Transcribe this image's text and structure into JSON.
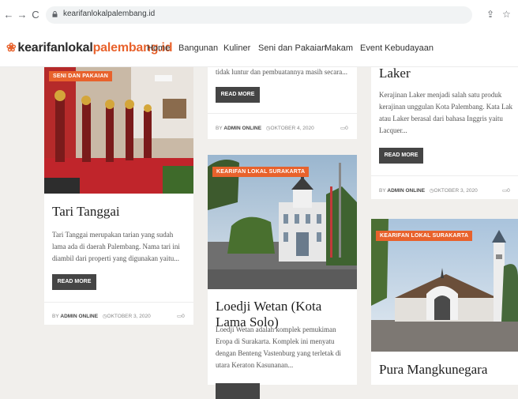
{
  "browser": {
    "url": "kearifanlokalpalembang.id",
    "back_glyph": "←",
    "forward_glyph": "→",
    "reload_glyph": "C",
    "share_glyph": "⇪",
    "star_glyph": "☆"
  },
  "site": {
    "logo_prefix": "kearifanlokal",
    "logo_accent": "palembang.id",
    "logo_mark": "❀",
    "accent_color": "#e8622c",
    "nav": [
      "Home",
      "Bangunan",
      "Kuliner",
      "Seni dan Pakaian",
      "Makam",
      "Event Kebudayaan"
    ]
  },
  "posts": [
    {
      "badge": "SENI DAN PAKAIAN",
      "title": "Tari Tanggai",
      "excerpt": "Tari Tanggai merupakan tarian yang sudah lama ada di daerah Palembang. Nama tari ini diambil dari properti yang digunakan yaitu...",
      "button": "READ MORE",
      "author_prefix": "BY",
      "author": "ADMIN ONLINE",
      "date": "OKTOBER 3, 2020",
      "comments": "0"
    },
    {
      "excerpt_tail": "tidak luntur dan pembuatannya masih secara...",
      "button": "READ MORE",
      "author_prefix": "BY",
      "author": "ADMIN ONLINE",
      "date": "OKTOBER 4, 2020",
      "comments": "0"
    },
    {
      "badge": "KEARIFAN LOKAL SURAKARTA",
      "title": "Loedji Wetan (Kota Lama Solo)",
      "excerpt": "Loedji Wetan adalah komplek pemukiman Eropa di Surakarta. Komplek ini menyatu dengan Benteng Vastenburg yang terletak di utara Keraton Kasunanan..."
    },
    {
      "title": "Laker",
      "excerpt": "Kerajinan Laker menjadi salah satu produk kerajinan unggulan Kota Palembang. Kata Lak atau Laker berasal dari bahasa Inggris yaitu Lacquer...",
      "button": "READ MORE",
      "author_prefix": "BY",
      "author": "ADMIN ONLINE",
      "date": "OKTOBER 3, 2020",
      "comments": "0"
    },
    {
      "badge": "KEARIFAN LOKAL SURAKARTA",
      "title": "Pura Mangkunegara"
    }
  ]
}
